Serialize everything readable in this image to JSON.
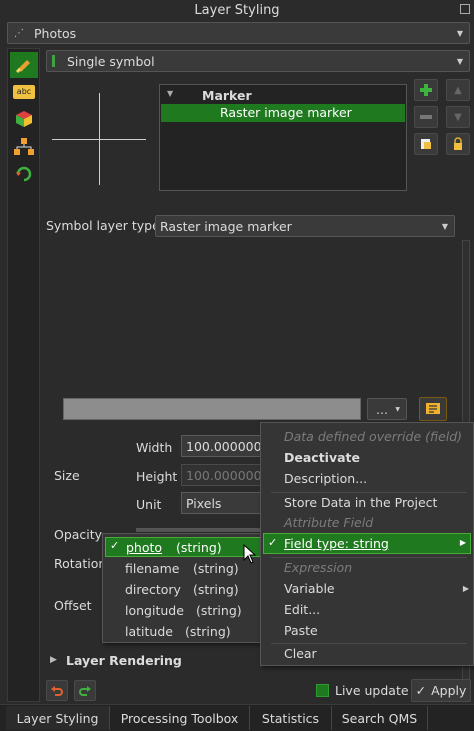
{
  "window": {
    "title": "Layer Styling"
  },
  "layer_select": {
    "value": "Photos"
  },
  "renderer_select": {
    "value": "Single symbol"
  },
  "symbol_tree": {
    "parent": "Marker",
    "child": "Raster image marker"
  },
  "symbol_layer_type": {
    "label": "Symbol layer type",
    "value": "Raster image marker"
  },
  "file_row": {
    "browse_label": "..."
  },
  "size": {
    "label": "Size",
    "width_label": "Width",
    "width_value": "100.000000",
    "height_label": "Height",
    "height_value": "100.000000",
    "unit_label": "Unit",
    "unit_value": "Pixels"
  },
  "opacity": {
    "label": "Opacity"
  },
  "rotation": {
    "label": "Rotation"
  },
  "offset": {
    "label": "Offset"
  },
  "field_menu": {
    "items": [
      {
        "name": "photo",
        "type": "(string)",
        "checked": true
      },
      {
        "name": "filename",
        "type": "(string)"
      },
      {
        "name": "directory",
        "type": "(string)"
      },
      {
        "name": "longitude",
        "type": "(string)"
      },
      {
        "name": "latitude",
        "type": "(string)"
      }
    ]
  },
  "dd_menu": {
    "header": "Data defined override (field)",
    "deactivate": "Deactivate",
    "description": "Description...",
    "store": "Store Data in the Project",
    "attribute_field": "Attribute Field",
    "field_type": "Field type: string",
    "expression": "Expression",
    "variable": "Variable",
    "edit": "Edit...",
    "paste": "Paste",
    "clear": "Clear"
  },
  "layer_rendering": {
    "label": "Layer Rendering"
  },
  "bottom": {
    "live_update": "Live update",
    "apply": "Apply"
  },
  "tabs": [
    "Layer Styling",
    "Processing Toolbox",
    "Statistics",
    "Search QMS"
  ],
  "colors": {
    "accent": "#1f7a1f",
    "background": "#2b2b2b",
    "highlight": "#3c9a2c"
  }
}
